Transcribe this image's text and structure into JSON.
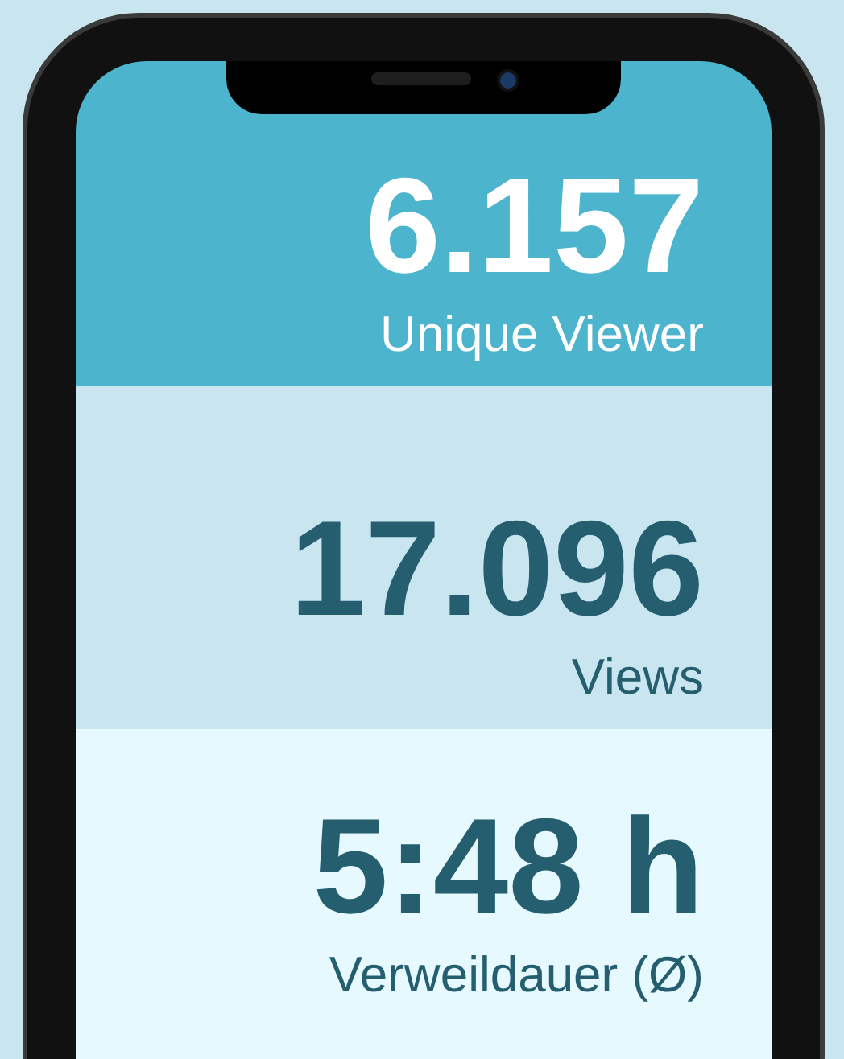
{
  "stats": [
    {
      "value": "6.157",
      "label": "Unique Viewer",
      "kind": "highlight",
      "color": "#4cb4cd"
    },
    {
      "value": "17.096",
      "label": "Views",
      "kind": "plain",
      "color": "#c8e5f0"
    },
    {
      "value": "5:48 h",
      "label": "Verweildauer (Ø)",
      "kind": "plain",
      "color": "#e6f9fe"
    }
  ]
}
